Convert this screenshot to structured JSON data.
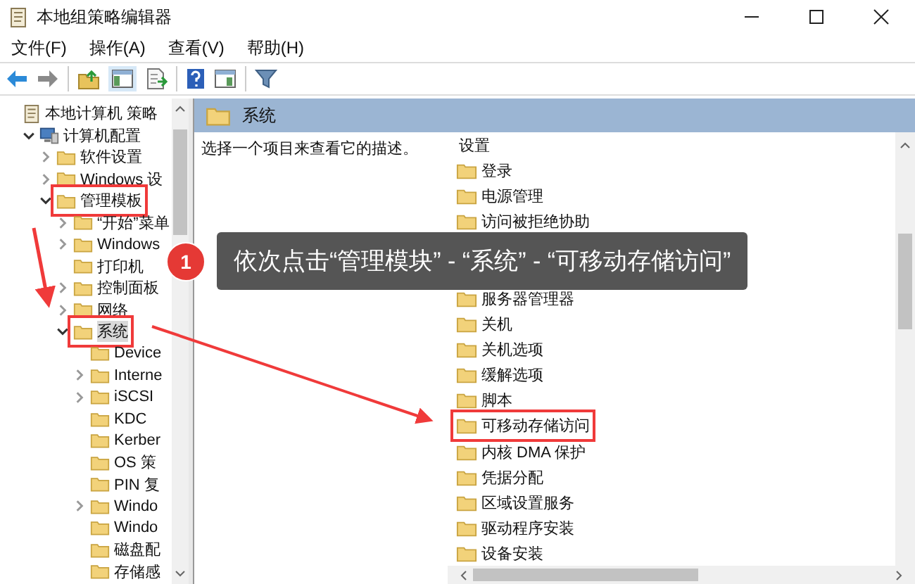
{
  "window": {
    "title": "本地组策略编辑器"
  },
  "menu": [
    "文件(F)",
    "操作(A)",
    "查看(V)",
    "帮助(H)"
  ],
  "tree": [
    {
      "label": "本地计算机 策略",
      "kind": "root",
      "expandable": false,
      "selected": false,
      "highlighted": false,
      "children": [
        {
          "label": "计算机配置",
          "kind": "computer",
          "expandable": true,
          "expanded": true,
          "selected": false,
          "highlighted": false,
          "children": [
            {
              "label": "软件设置",
              "kind": "folder",
              "expandable": true,
              "expanded": false,
              "selected": false,
              "highlighted": false
            },
            {
              "label": "Windows 设",
              "kind": "folder",
              "expandable": true,
              "expanded": false,
              "selected": false,
              "highlighted": false
            },
            {
              "label": "管理模板",
              "kind": "folder",
              "expandable": true,
              "expanded": true,
              "selected": false,
              "highlighted": true,
              "children": [
                {
                  "label": "“开始”菜单",
                  "kind": "folder",
                  "expandable": true,
                  "expanded": false,
                  "selected": false,
                  "highlighted": false
                },
                {
                  "label": "Windows",
                  "kind": "folder",
                  "expandable": true,
                  "expanded": false,
                  "selected": false,
                  "highlighted": false
                },
                {
                  "label": "打印机",
                  "kind": "folder",
                  "expandable": false,
                  "selected": false,
                  "highlighted": false
                },
                {
                  "label": "控制面板",
                  "kind": "folder",
                  "expandable": true,
                  "expanded": false,
                  "selected": false,
                  "highlighted": false
                },
                {
                  "label": "网络",
                  "kind": "folder",
                  "expandable": true,
                  "expanded": false,
                  "selected": false,
                  "highlighted": false
                },
                {
                  "label": "系统",
                  "kind": "folder",
                  "expandable": true,
                  "expanded": true,
                  "selected": true,
                  "highlighted": true,
                  "children": [
                    {
                      "label": "Device",
                      "kind": "folder",
                      "expandable": false,
                      "selected": false,
                      "highlighted": false
                    },
                    {
                      "label": "Interne",
                      "kind": "folder",
                      "expandable": true,
                      "expanded": false,
                      "selected": false,
                      "highlighted": false
                    },
                    {
                      "label": "iSCSI",
                      "kind": "folder",
                      "expandable": true,
                      "expanded": false,
                      "selected": false,
                      "highlighted": false
                    },
                    {
                      "label": "KDC",
                      "kind": "folder",
                      "expandable": false,
                      "selected": false,
                      "highlighted": false
                    },
                    {
                      "label": "Kerber",
                      "kind": "folder",
                      "expandable": false,
                      "selected": false,
                      "highlighted": false
                    },
                    {
                      "label": "OS 策",
                      "kind": "folder",
                      "expandable": false,
                      "selected": false,
                      "highlighted": false
                    },
                    {
                      "label": "PIN 复",
                      "kind": "folder",
                      "expandable": false,
                      "selected": false,
                      "highlighted": false
                    },
                    {
                      "label": "Windo",
                      "kind": "folder",
                      "expandable": true,
                      "expanded": false,
                      "selected": false,
                      "highlighted": false
                    },
                    {
                      "label": "Windo",
                      "kind": "folder",
                      "expandable": false,
                      "selected": false,
                      "highlighted": false
                    },
                    {
                      "label": "磁盘配",
                      "kind": "folder",
                      "expandable": false,
                      "selected": false,
                      "highlighted": false
                    },
                    {
                      "label": "存储感",
                      "kind": "folder",
                      "expandable": false,
                      "selected": false,
                      "highlighted": false
                    }
                  ]
                }
              ]
            }
          ]
        }
      ]
    }
  ],
  "details": {
    "title": "系统",
    "description": "选择一个项目来查看它的描述。",
    "column": "设置",
    "items_above": [
      {
        "label": "登录",
        "highlighted": false
      },
      {
        "label": "电源管理",
        "highlighted": false
      },
      {
        "label": "访问被拒绝协助",
        "highlighted": false
      }
    ],
    "items_below": [
      {
        "label": "服务器管理器",
        "highlighted": false
      },
      {
        "label": "关机",
        "highlighted": false
      },
      {
        "label": "关机选项",
        "highlighted": false
      },
      {
        "label": "缓解选项",
        "highlighted": false
      },
      {
        "label": "脚本",
        "highlighted": false
      },
      {
        "label": "可移动存储访问",
        "highlighted": true
      },
      {
        "label": "内核 DMA 保护",
        "highlighted": false
      },
      {
        "label": "凭据分配",
        "highlighted": false
      },
      {
        "label": "区域设置服务",
        "highlighted": false
      },
      {
        "label": "驱动程序安装",
        "highlighted": false
      },
      {
        "label": "设备安装",
        "highlighted": false
      }
    ]
  },
  "annotation": {
    "badge": "1",
    "text": "依次点击“管理模块” - “系统” - “可移动存储访问”"
  }
}
